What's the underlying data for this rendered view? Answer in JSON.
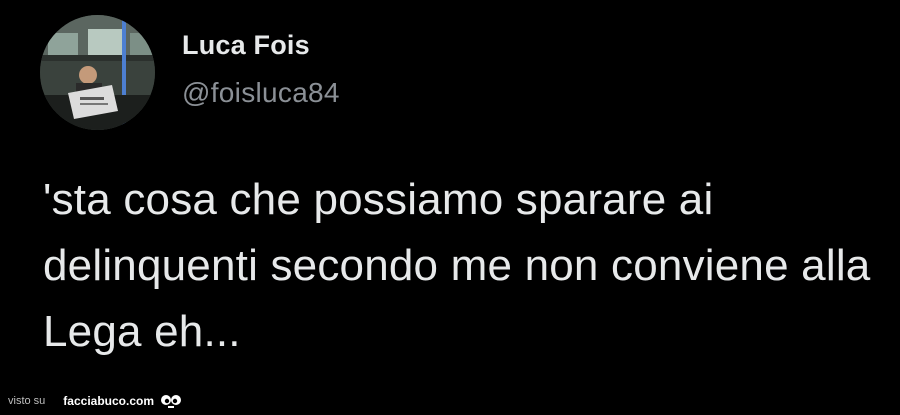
{
  "tweet": {
    "display_name": "Luca Fois",
    "handle": "@foisluca84",
    "text": "'sta cosa che possiamo sparare ai delinquenti secondo me non conviene alla Lega eh..."
  },
  "watermark": {
    "prefix": "visto su",
    "site": "facciabuco.com"
  },
  "icons": {
    "avatar": "avatar-photo",
    "eyes": "googly-eyes-icon"
  },
  "colors": {
    "background": "#000000",
    "text": "#e7e9ea",
    "handle": "#8b9096"
  }
}
